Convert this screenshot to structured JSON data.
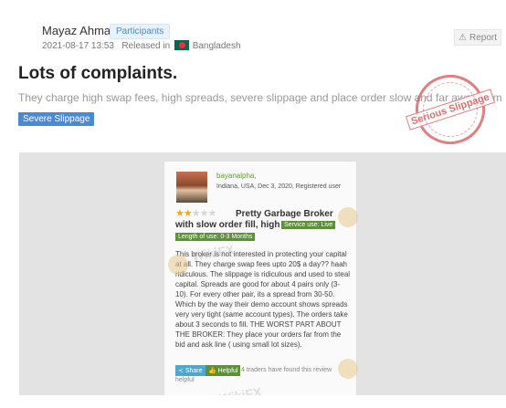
{
  "post": {
    "author": "Mayaz Ahmad",
    "role": "Participants",
    "date": "2021-08-17 13:53",
    "released_in_label": "Released in",
    "country": "Bangladesh",
    "report_label": "Report",
    "title": "Lots of complaints.",
    "description": "They charge high swap fees, high spreads, severe slippage and place order slow and far away from the price.",
    "tag": "Severe Slippage",
    "stamp_text": "Serious Slippage"
  },
  "review": {
    "username": "bayanalpha,",
    "meta": "Indiana, USA, Dec 3, 2020, Registered user",
    "rating": 2,
    "max_rating": 5,
    "title_line1": "Pretty Garbage Broker",
    "title_line2": "with slow order fill, high",
    "service_badge": "Service use: Live",
    "length_badge": "Length of use: 0-3 Months",
    "body": "This broker is not interested in protecting your capital at all. They charge swap fees upto 20$ a day?? haah ridiculous. The slippage is ridiculous and used to steal capital. Spreads are good for about 4 pairs only (3-10). For every other pair, its a spread from 30-50. Which by the way their demo account shows spreads very very tight (same account types). The orders take about 3 seconds to fill. THE WORST PART ABOUT THE BROKER: They place your orders far from the bid and ask line ( using small lot sizes).",
    "share_label": "Share",
    "helpful_label": "Helpful",
    "helpful_text": "4 traders have found this review helpful"
  },
  "icons": {
    "report": "warning-triangle-icon",
    "flag": "bangladesh-flag-icon",
    "share": "share-icon",
    "helpful": "thumbs-up-icon",
    "star": "star-icon"
  },
  "colors": {
    "tag_bg": "#4a8ad4",
    "badge_green": "#5e8f3a",
    "stamp_red": "#d65656",
    "star_on": "#f0a62a"
  }
}
